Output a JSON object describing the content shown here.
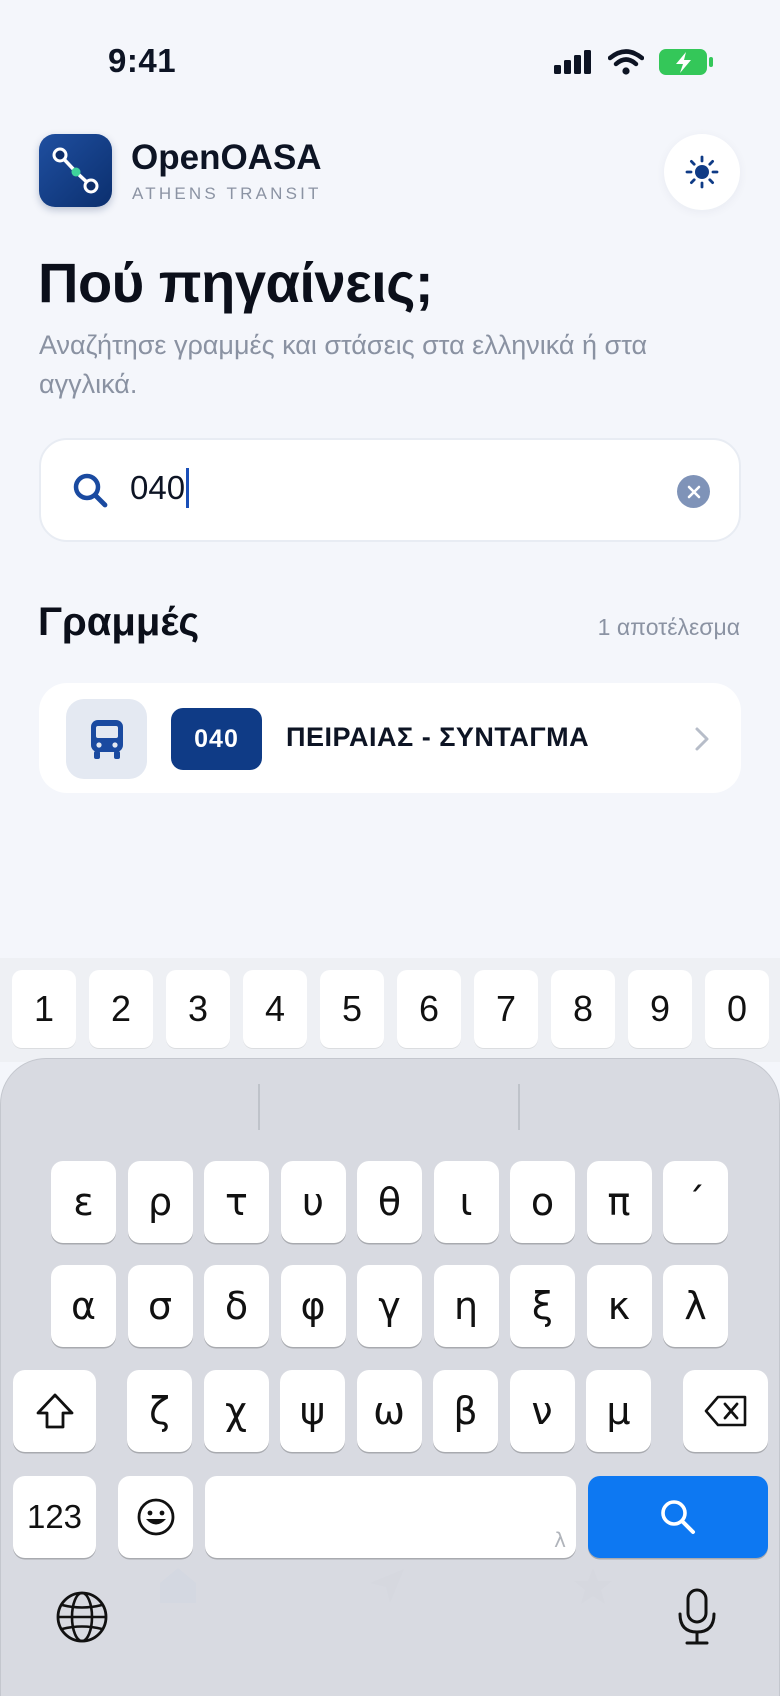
{
  "status_bar": {
    "time": "9:41"
  },
  "app": {
    "name": "OpenOASA",
    "subtitle": "ATHENS TRANSIT"
  },
  "page": {
    "title": "Πού πηγαίνεις;",
    "subtitle": "Αναζήτησε γραμμές και στάσεις στα ελληνικά ή στα αγγλικά."
  },
  "search": {
    "value": "040"
  },
  "results": {
    "section_title": "Γραμμές",
    "count_label": "1 αποτέλεσμα",
    "items": [
      {
        "line_number": "040",
        "name": "ΠΕΙΡΑΙΑΣ - ΣΥΝΤΑΓΜΑ"
      }
    ]
  },
  "keyboard": {
    "number_row": [
      "1",
      "2",
      "3",
      "4",
      "5",
      "6",
      "7",
      "8",
      "9",
      "0"
    ],
    "row1": [
      "ε",
      "ρ",
      "τ",
      "υ",
      "θ",
      "ι",
      "ο",
      "π",
      "´"
    ],
    "row2": [
      "α",
      "σ",
      "δ",
      "φ",
      "γ",
      "η",
      "ξ",
      "κ",
      "λ"
    ],
    "row3": [
      "ζ",
      "χ",
      "ψ",
      "ω",
      "β",
      "ν",
      "μ"
    ],
    "numbers_key": "123",
    "space_hint": "λ"
  },
  "colors": {
    "accent": "#0d78f2",
    "brand": "#0f3b86",
    "background": "#f4f6fb"
  }
}
